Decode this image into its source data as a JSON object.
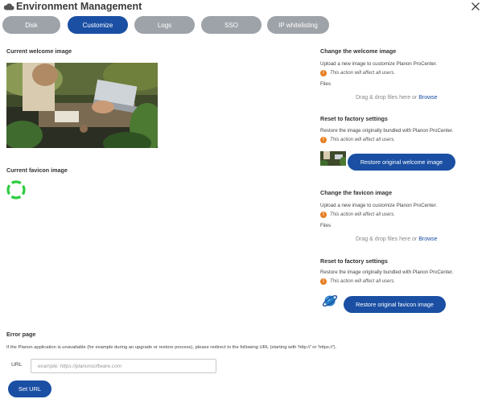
{
  "window": {
    "title": "Environment Management",
    "close_icon": "close-icon",
    "app_icon": "cloud-icon"
  },
  "tabs": [
    {
      "label": "Disk",
      "active": false
    },
    {
      "label": "Customize",
      "active": true
    },
    {
      "label": "Logs",
      "active": false
    },
    {
      "label": "SSO",
      "active": false
    },
    {
      "label": "IP whitelisting",
      "active": false
    }
  ],
  "colors": {
    "accent": "#1a4fa3",
    "tab_inactive": "#9ea3a9",
    "warning": "#e67e22",
    "favicon_green": "#2ecc40"
  },
  "left": {
    "welcome_heading": "Current welcome image",
    "favicon_heading": "Current favicon image"
  },
  "welcome": {
    "change_heading": "Change the welcome image",
    "upload_text": "Upload a new image to customize Planon ProCenter.",
    "warning": "This action will affect all users.",
    "files_label": "Files",
    "drop_text": "Drag & drop files here or ",
    "browse": "Browse",
    "reset_heading": "Reset to factory settings",
    "reset_text": "Restore the image originally bundled with Planon ProCenter.",
    "reset_warning": "This action will affect all users.",
    "restore_button": "Restore original welcome image"
  },
  "favicon": {
    "change_heading": "Change the favicon image",
    "upload_text": "Upload a new image to customize Planon ProCenter.",
    "warning": "This action will affect all users.",
    "files_label": "Files",
    "drop_text": "Drag & drop files here or ",
    "browse": "Browse",
    "reset_heading": "Reset to factory settings",
    "reset_text": "Restore the image originally bundled with Planon ProCenter.",
    "reset_warning": "This action will affect all users.",
    "restore_button": "Restore original favicon image"
  },
  "error_page": {
    "heading": "Error page",
    "description": "If the Planon application is unavailable (for example during an upgrade or restore process), please redirect to the following URL (starting with 'http://' or 'https://').",
    "url_label": "URL",
    "url_placeholder": "example: https://planonsoftware.com",
    "url_value": "",
    "set_button": "Set URL"
  }
}
